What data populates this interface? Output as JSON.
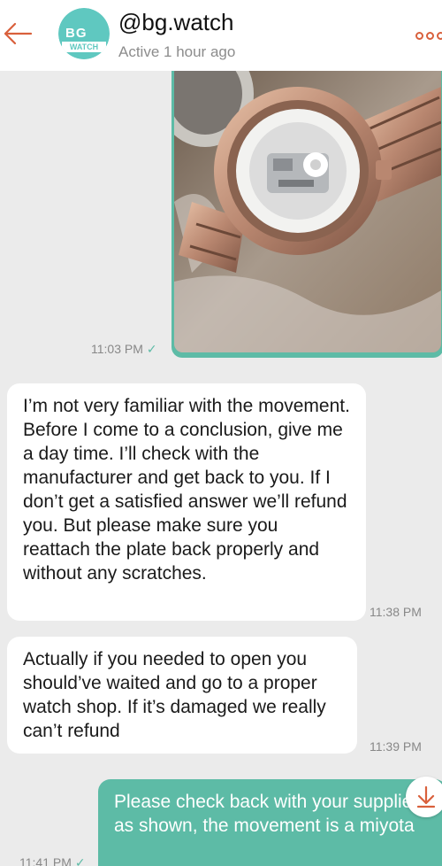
{
  "header": {
    "username": "@bg.watch",
    "status": "Active 1 hour ago",
    "avatar_text_top": "BG",
    "avatar_text_bottom": "WATCH"
  },
  "colors": {
    "accent": "#5dbba6",
    "brand_orange": "#d9603c",
    "background": "#ebebeb"
  },
  "messages": [
    {
      "type": "image",
      "direction": "outgoing",
      "time": "11:03 PM",
      "read": true
    },
    {
      "type": "text",
      "direction": "incoming",
      "text": "I’m not very familiar with the movement. Before I come to a conclusion, give me a day time. I’ll check with the manufacturer and get back to you. If I don’t get a satisfied answer we’ll refund you. But please make sure you reattach the plate back properly and without any scratches.",
      "time": "11:38 PM"
    },
    {
      "type": "text",
      "direction": "incoming",
      "text": "Actually if you needed to open you should’ve waited and go to a proper watch shop. If it’s damaged we really can’t refund",
      "time": "11:39 PM"
    },
    {
      "type": "text",
      "direction": "outgoing",
      "text": "Please check back with your supplier as shown, the movement is a miyota",
      "time": "11:41 PM",
      "read": true
    }
  ]
}
